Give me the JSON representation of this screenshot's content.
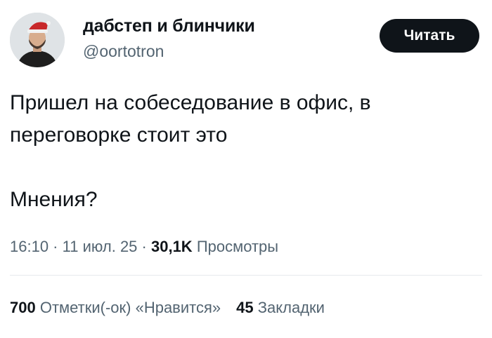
{
  "author": {
    "display_name": "дабстеп и блинчики",
    "handle": "@oortotron"
  },
  "follow_button": {
    "label": "Читать"
  },
  "tweet": {
    "line1": "Пришел на собеседование в офис, в",
    "line2": "переговорке стоит это",
    "line3": "Мнения?"
  },
  "meta": {
    "time": "16:10",
    "sep1": " · ",
    "date": "11 июл. 25",
    "sep2": " · ",
    "views_count": "30,1K",
    "views_label": " Просмотры"
  },
  "stats": {
    "likes_count": "700",
    "likes_label": " Отметки(-ок) «Нравится»",
    "bookmarks_count": "45",
    "bookmarks_label": " Закладки"
  },
  "colors": {
    "text": "#0f1419",
    "secondary": "#536471",
    "button_bg": "#0f1419",
    "divider": "#e6e9ec"
  }
}
